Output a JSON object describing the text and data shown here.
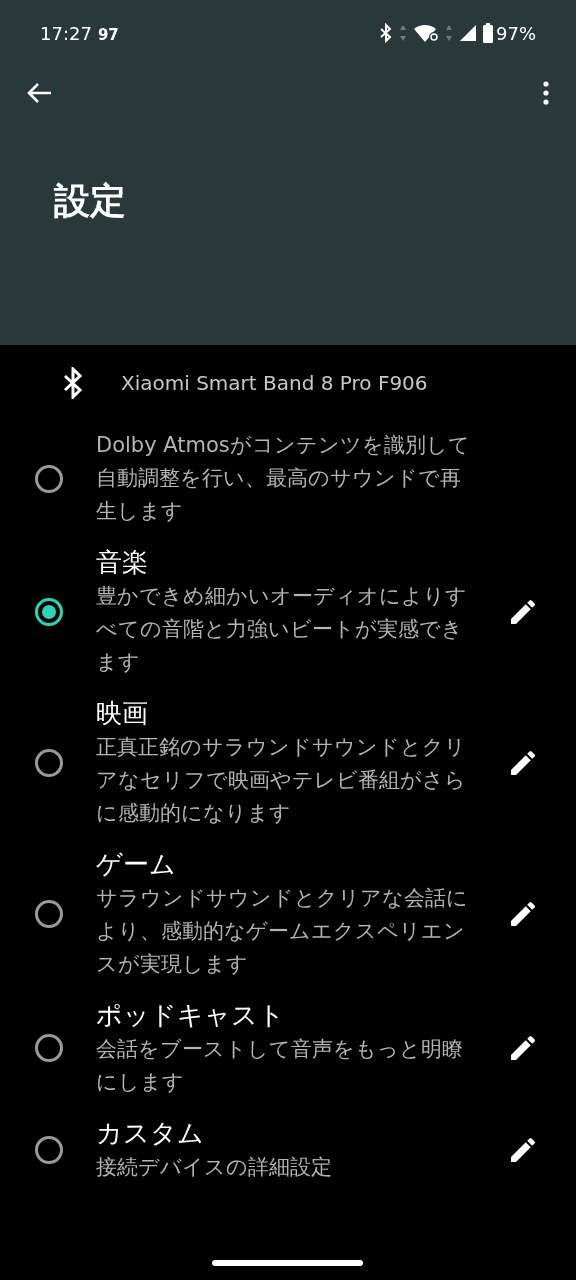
{
  "status_bar": {
    "time": "17:27",
    "extra": "97",
    "battery": "97%"
  },
  "app_bar": {
    "title": "設定"
  },
  "device": {
    "name": "Xiaomi Smart Band 8 Pro F906"
  },
  "options": [
    {
      "description": "Dolby Atmosがコンテンツを識別して自動調整を行い、最高のサウンドで再生します",
      "selected": false,
      "editable": false
    },
    {
      "title": "音楽",
      "description": "豊かできめ細かいオーディオによりすべての音階と力強いビートが実感できます",
      "selected": true,
      "editable": true
    },
    {
      "title": "映画",
      "description": "正真正銘のサラウンドサウンドとクリアなセリフで映画やテレビ番組がさらに感動的になります",
      "selected": false,
      "editable": true
    },
    {
      "title": "ゲーム",
      "description": "サラウンドサウンドとクリアな会話により、感動的なゲームエクスペリエンスが実現します",
      "selected": false,
      "editable": true
    },
    {
      "title": "ポッドキャスト",
      "description": "会話をブーストして音声をもっと明瞭にします",
      "selected": false,
      "editable": true
    },
    {
      "title": "カスタム",
      "description": "接続デバイスの詳細設定",
      "selected": false,
      "editable": true
    }
  ]
}
